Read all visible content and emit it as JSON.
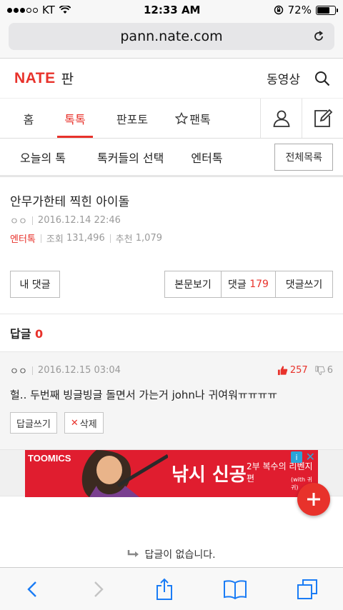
{
  "statusbar": {
    "carrier": "KT",
    "time": "12:33 AM",
    "battery": "72%",
    "battery_level": 0.72
  },
  "browser": {
    "url": "pann.nate.com"
  },
  "header": {
    "logo": "NATE",
    "section": "판",
    "video_label": "동영상"
  },
  "main_nav": {
    "tabs": [
      {
        "label": "홈"
      },
      {
        "label": "톡톡"
      },
      {
        "label": "판포토"
      },
      {
        "label": "팬톡"
      }
    ]
  },
  "sub_nav": {
    "items": [
      {
        "label": "오늘의 톡"
      },
      {
        "label": "톡커들의 선택"
      },
      {
        "label": "엔터톡"
      }
    ],
    "all_label": "전체목록"
  },
  "post": {
    "title": "안무가한테 찍힌 아이돌",
    "author": "ㅇㅇ",
    "date": "2016.12.14 22:46",
    "category": "엔터톡",
    "views_label": "조회",
    "views": "131,496",
    "recommend_label": "추천",
    "recommend": "1,079"
  },
  "actions": {
    "my_comments": "내 댓글",
    "view_post": "본문보기",
    "comments_label": "댓글",
    "comments_count": "179",
    "write_comment": "댓글쓰기"
  },
  "replies": {
    "label": "답글",
    "count": "0"
  },
  "comment": {
    "author": "ㅇㅇ",
    "date": "2016.12.15 03:04",
    "likes": "257",
    "dislikes": "6",
    "text": "헐.. 두번째 빙글빙글 돌면서 가는거 john나 귀여워ㅠㅠㅠㅠ",
    "reply_btn": "답글쓰기",
    "delete_btn": "삭제"
  },
  "ad": {
    "brand": "TOOMICS",
    "headline": "낚시 신공",
    "sub": "2부 복수의 리벤지편",
    "sub_small": "(with 귀귀)"
  },
  "empty_message": "답글이 없습니다.",
  "colors": {
    "accent": "#e8322b",
    "ad_bg": "#e01d2f",
    "ios_blue": "#1a7cf5"
  }
}
